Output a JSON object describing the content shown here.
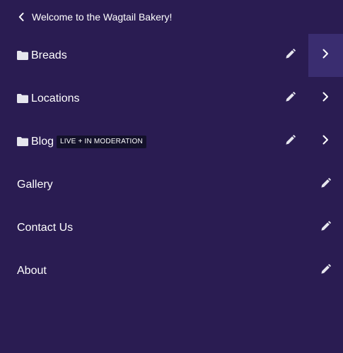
{
  "header": {
    "back_label": "Welcome to the Wagtail Bakery!"
  },
  "menu": {
    "items": [
      {
        "label": "Breads",
        "has_children": true,
        "badge": "",
        "active": true
      },
      {
        "label": "Locations",
        "has_children": true,
        "badge": "",
        "active": false
      },
      {
        "label": "Blog",
        "has_children": true,
        "badge": "LIVE + IN MODERATION",
        "active": false
      },
      {
        "label": "Gallery",
        "has_children": false,
        "badge": "",
        "active": false
      },
      {
        "label": "Contact Us",
        "has_children": false,
        "badge": "",
        "active": false
      },
      {
        "label": "About",
        "has_children": false,
        "badge": "",
        "active": false
      }
    ]
  },
  "icons": {
    "back": "chevron-left-icon",
    "folder": "folder-icon",
    "edit": "pencil-icon",
    "explore": "chevron-right-icon"
  },
  "colors": {
    "background": "#2a1c52",
    "active_explore_background": "#3a2d70",
    "badge_background": "#13112a",
    "text": "#ffffff",
    "icon": "#e6e6ee"
  }
}
